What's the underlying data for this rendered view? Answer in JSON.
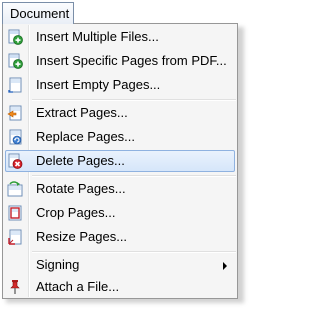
{
  "menubar": {
    "title": "Document"
  },
  "menu": {
    "items": [
      {
        "label": "Insert Multiple Files...",
        "icon": "insert-files-icon"
      },
      {
        "label": "Insert Specific Pages from PDF...",
        "icon": "insert-pdf-pages-icon"
      },
      {
        "label": "Insert Empty Pages...",
        "icon": "insert-empty-page-icon"
      },
      {
        "label": "Extract Pages...",
        "icon": "extract-pages-icon"
      },
      {
        "label": "Replace Pages...",
        "icon": "replace-pages-icon"
      },
      {
        "label": "Delete Pages...",
        "icon": "delete-pages-icon",
        "highlighted": true
      },
      {
        "label": "Rotate Pages...",
        "icon": "rotate-pages-icon"
      },
      {
        "label": "Crop Pages...",
        "icon": "crop-pages-icon"
      },
      {
        "label": "Resize Pages...",
        "icon": "resize-pages-icon"
      },
      {
        "label": "Signing",
        "submenu": true
      },
      {
        "label": "Attach a File...",
        "icon": "pushpin-icon"
      }
    ]
  },
  "colors": {
    "highlight_fill": "#d6e6fa",
    "highlight_border": "#8fb2e0",
    "menu_background": "#f5f5f5",
    "menu_border": "#979797"
  }
}
